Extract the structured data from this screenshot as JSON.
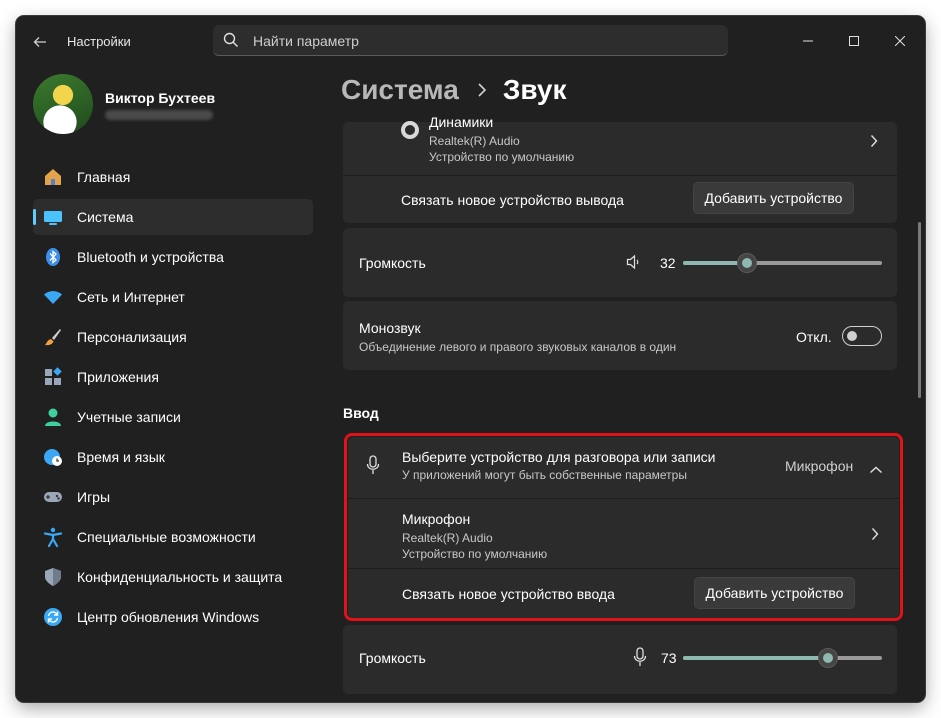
{
  "window": {
    "title": "Настройки"
  },
  "search": {
    "placeholder": "Найти параметр"
  },
  "user": {
    "name": "Виктор Бухтеев"
  },
  "nav": [
    {
      "label": "Главная",
      "icon": "home-icon",
      "color": "#e3a34b"
    },
    {
      "label": "Система",
      "icon": "display-icon",
      "color": "#4cc2ff",
      "active": true
    },
    {
      "label": "Bluetooth и устройства",
      "icon": "bluetooth-icon",
      "color": "#3b8eea"
    },
    {
      "label": "Сеть и Интернет",
      "icon": "wifi-icon",
      "color": "#3ba8f5"
    },
    {
      "label": "Персонализация",
      "icon": "brush-icon",
      "color": "#f0a040"
    },
    {
      "label": "Приложения",
      "icon": "apps-icon",
      "color": "#9aa7b8"
    },
    {
      "label": "Учетные записи",
      "icon": "person-icon",
      "color": "#3ed0a0"
    },
    {
      "label": "Время и язык",
      "icon": "globe-clock-icon",
      "color": "#3ba8f5"
    },
    {
      "label": "Игры",
      "icon": "gamepad-icon",
      "color": "#9aa7b8"
    },
    {
      "label": "Специальные возможности",
      "icon": "accessibility-icon",
      "color": "#3ba8f5"
    },
    {
      "label": "Конфиденциальность и защита",
      "icon": "shield-icon",
      "color": "#9aa7b8"
    },
    {
      "label": "Центр обновления Windows",
      "icon": "update-icon",
      "color": "#3ba8f5"
    }
  ],
  "breadcrumb": {
    "parent": "Система",
    "current": "Звук"
  },
  "output": {
    "device_name": "Динамики",
    "device_driver": "Realtek(R) Audio",
    "device_status": "Устройство по умолчанию",
    "pair_label": "Связать новое устройство вывода",
    "add_button": "Добавить устройство",
    "volume_label": "Громкость",
    "volume_value": "32",
    "volume_level": 0.32
  },
  "mono": {
    "title": "Монозвук",
    "description": "Объединение левого и правого звуковых каналов в один",
    "state": "Откл."
  },
  "input": {
    "section_title": "Ввод",
    "choose_title": "Выберите устройство для разговора или записи",
    "choose_subtitle": "У приложений могут быть собственные параметры",
    "selected": "Микрофон",
    "device_name": "Микрофон",
    "device_driver": "Realtek(R) Audio",
    "device_status": "Устройство по умолчанию",
    "pair_label": "Связать новое устройство ввода",
    "add_button": "Добавить устройство",
    "volume_label": "Громкость",
    "volume_value": "73",
    "volume_level": 0.73
  },
  "colors": {
    "accent": "#60cdff",
    "slider": "#8fb8b1",
    "highlight": "#e0121a"
  }
}
